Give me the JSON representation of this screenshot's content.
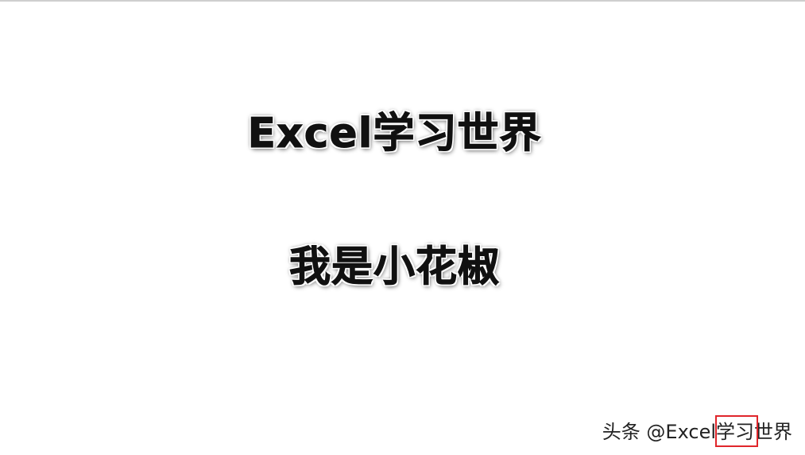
{
  "slide": {
    "line1": "Excel学习世界",
    "line2": "我是小花椒"
  },
  "watermark": {
    "text": "头条 @Excel学习世界"
  },
  "colors": {
    "text": "#111111",
    "background": "#ffffff",
    "highlight": "#e0262b"
  }
}
